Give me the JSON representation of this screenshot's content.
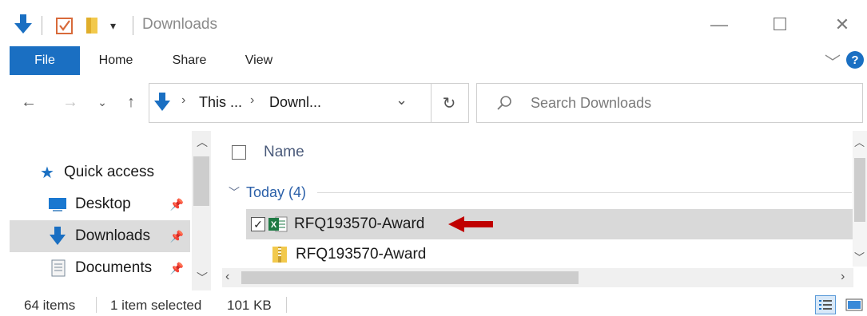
{
  "window": {
    "title": "Downloads",
    "minimize_glyph": "—",
    "maximize_glyph": "☐",
    "close_glyph": "✕"
  },
  "ribbon": {
    "tabs": [
      "File",
      "Home",
      "Share",
      "View"
    ],
    "help_label": "?"
  },
  "navigation": {
    "breadcrumb": [
      "This ...",
      "Downl..."
    ],
    "search_placeholder": "Search Downloads"
  },
  "sidebar": {
    "items": [
      {
        "label": "Quick access",
        "icon": "star-icon",
        "pinned": false
      },
      {
        "label": "Desktop",
        "icon": "desktop-icon",
        "pinned": true
      },
      {
        "label": "Downloads",
        "icon": "download-arrow-icon",
        "pinned": true,
        "selected": true
      },
      {
        "label": "Documents",
        "icon": "document-icon",
        "pinned": true
      }
    ]
  },
  "file_list": {
    "column_name": "Name",
    "group_label": "Today (4)",
    "files": [
      {
        "name": "RFQ193570-Award",
        "icon": "excel-file-icon",
        "selected": true,
        "checked": true
      },
      {
        "name": "RFQ193570-Award",
        "icon": "zip-folder-icon",
        "selected": false,
        "checked": false
      }
    ]
  },
  "status": {
    "item_count": "64 items",
    "selection": "1 item selected",
    "size": "101 KB"
  },
  "colors": {
    "accent_blue": "#1a6fc2",
    "annotation_red": "#c00000",
    "selection_gray": "#d9d9d9"
  }
}
